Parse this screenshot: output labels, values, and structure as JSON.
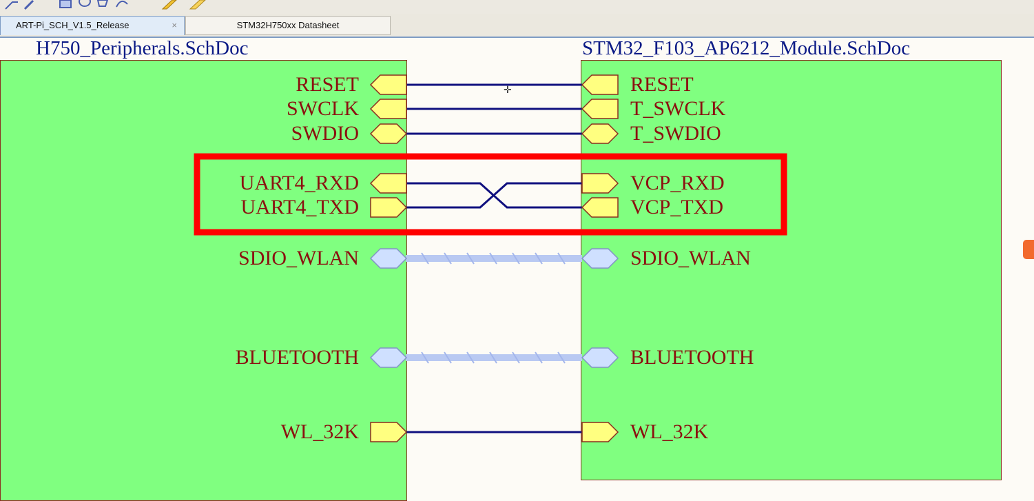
{
  "tabs": [
    {
      "label": "ART-Pi_SCH_V1.5_Release",
      "active": true,
      "close_glyph": "×"
    },
    {
      "label": "STM32H750xx Datasheet",
      "active": false
    }
  ],
  "left_sheet": {
    "designator": "H750_Peripherals.SchDoc",
    "ports": [
      "RESET",
      "SWCLK",
      "SWDIO",
      "UART4_RXD",
      "UART4_TXD",
      "SDIO_WLAN",
      "BLUETOOTH",
      "WL_32K"
    ]
  },
  "right_sheet": {
    "designator": "STM32_F103_AP6212_Module.SchDoc",
    "ports": [
      "RESET",
      "T_SWCLK",
      "T_SWDIO",
      "VCP_RXD",
      "VCP_TXD",
      "SDIO_WLAN",
      "BLUETOOTH",
      "WL_32K"
    ]
  },
  "colors": {
    "sheet_fill": "#80ff80",
    "port_fill": "#ffff80",
    "bus_port_fill": "#cfe0ff",
    "wire": "#10107f",
    "highlight": "#ff0000",
    "port_text": "#8b1010",
    "designator_text": "#0b1a86"
  },
  "icons": [
    "wire-tool-icon",
    "bus-tool-icon",
    "rectangle-tool-icon",
    "ellipse-tool-icon",
    "polygon-tool-icon",
    "arc-tool-icon",
    "pencil-tool-icon",
    "eraser-tool-icon"
  ]
}
